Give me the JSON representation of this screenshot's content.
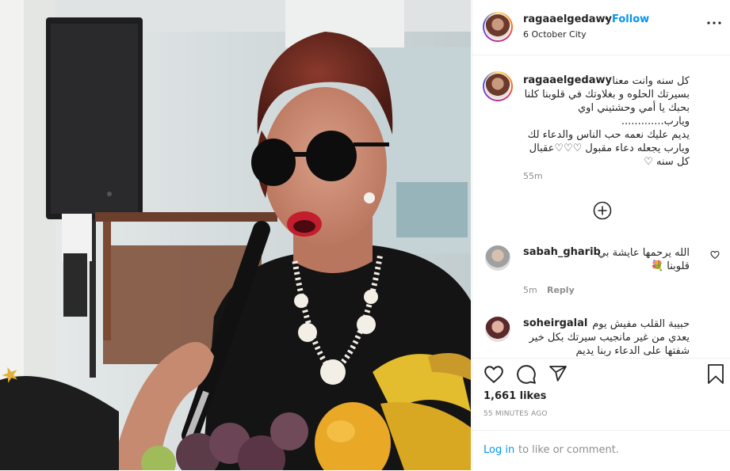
{
  "post": {
    "username": "ragaaelgedawy",
    "follow_separator": "•",
    "follow_label": "Follow",
    "location": "6 October City"
  },
  "caption": {
    "username": "ragaaelgedawy",
    "lines": [
      "كل سنه وانت معنا",
      "بسيرتك الحلوه و بغلاوتك في قلوبنا كلنا",
      "بحبك يا أمي وحشتيني اوي ويارب.............",
      "يديم عليك نعمه حب الناس والدعاء لك",
      "ويارب يجعله دعاء مقبول ♡♡♡عقبال",
      "كل سنه ♡"
    ],
    "time": "55m"
  },
  "comments": [
    {
      "username": "sabah_gharib",
      "text_lines": [
        "الله يرحمها عايشة بي",
        "قلوبنا 💐"
      ],
      "time": "5m",
      "reply_label": "Reply"
    },
    {
      "username": "soheirgalal",
      "text_lines": [
        "حبيبة القلب مفيش يوم",
        "يعدي من غير مانجيب سيرتك بكل خير",
        "شفتها على الدعاء ربنا يديم"
      ]
    }
  ],
  "likes_text": "1,661 likes",
  "timestamp": "55 MINUTES AGO",
  "footer": {
    "login_label": "Log in",
    "rest": "to like or comment."
  },
  "icons": {
    "like": "heart-icon",
    "comment": "comment-icon",
    "share": "share-icon",
    "save": "bookmark-icon",
    "load_more": "plus-circle-icon"
  },
  "colors": {
    "link": "#0095f6",
    "secondary": "#8e8e8e",
    "border": "#efefef"
  }
}
